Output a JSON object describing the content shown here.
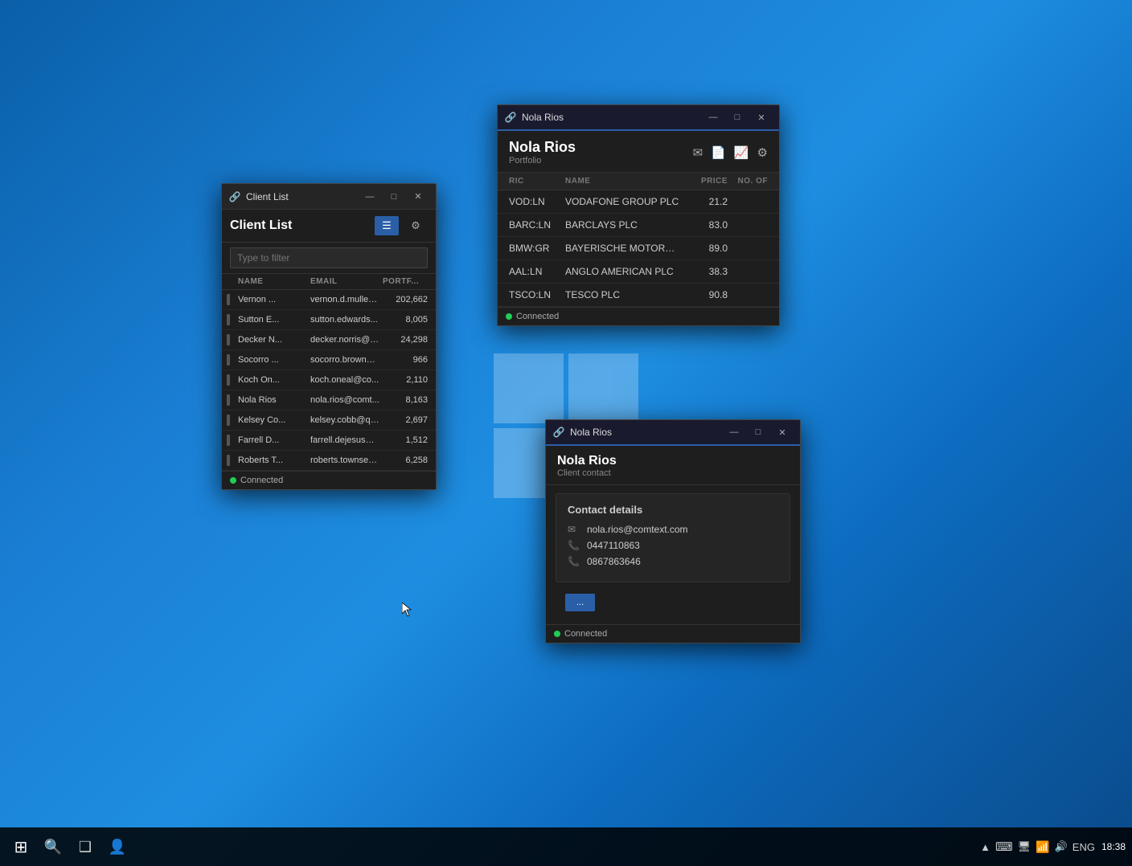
{
  "desktop": {
    "background": "blue-gradient"
  },
  "taskbar": {
    "icons": [
      {
        "name": "start-icon",
        "glyph": "⊞"
      },
      {
        "name": "search-icon",
        "glyph": "🔍"
      },
      {
        "name": "task-view-icon",
        "glyph": "❑"
      },
      {
        "name": "users-icon",
        "glyph": "👤"
      }
    ],
    "time": "18:38",
    "date": "",
    "sys_icons": [
      "▲",
      "⌨",
      "🖥",
      "🔊",
      "ENG"
    ]
  },
  "client_list_window": {
    "title": "Client List",
    "title_icon": "🔗",
    "controls": [
      "—",
      "□",
      "✕"
    ],
    "header_title": "Client List",
    "action_list": "≡",
    "action_settings": "⚙",
    "filter_placeholder": "Type to filter",
    "columns": {
      "indicator": "",
      "name": "NAME",
      "email": "EMAIL",
      "portfolio": "PORTF..."
    },
    "rows": [
      {
        "indicator": true,
        "name": "Vernon ...",
        "email": "vernon.d.mullen...",
        "portfolio": "202,662"
      },
      {
        "indicator": true,
        "name": "Sutton E...",
        "email": "sutton.edwards...",
        "portfolio": "8,005"
      },
      {
        "indicator": true,
        "name": "Decker N...",
        "email": "decker.norris@d...",
        "portfolio": "24,298"
      },
      {
        "indicator": true,
        "name": "Socorro ...",
        "email": "socorro.brown@...",
        "portfolio": "966"
      },
      {
        "indicator": true,
        "name": "Koch On...",
        "email": "koch.oneal@co...",
        "portfolio": "2,110"
      },
      {
        "indicator": true,
        "name": "Nola Rios",
        "email": "nola.rios@comt...",
        "portfolio": "8,163"
      },
      {
        "indicator": true,
        "name": "Kelsey Co...",
        "email": "kelsey.cobb@qo...",
        "portfolio": "2,697"
      },
      {
        "indicator": true,
        "name": "Farrell D...",
        "email": "farrell.dejesus@...",
        "portfolio": "1,512"
      },
      {
        "indicator": true,
        "name": "Roberts T...",
        "email": "roberts.townsen...",
        "portfolio": "6,258"
      }
    ],
    "status": "Connected"
  },
  "portfolio_window": {
    "title": "Nola Rios",
    "title_icon": "🔗",
    "controls": [
      "—",
      "□",
      "✕"
    ],
    "name": "Nola Rios",
    "subtitle": "Portfolio",
    "icons": [
      "✉",
      "📄",
      "📈",
      "⚙"
    ],
    "columns": {
      "ric": "RIC",
      "name": "NAME",
      "price": "PRICE",
      "no_of": "NO. OF"
    },
    "rows": [
      {
        "ric": "VOD:LN",
        "name": "VODAFONE GROUP PLC",
        "price": "21.2",
        "no_of": ""
      },
      {
        "ric": "BARC:LN",
        "name": "BARCLAYS PLC",
        "price": "83.0",
        "no_of": ""
      },
      {
        "ric": "BMW:GR",
        "name": "BAYERISCHE MOTOREN WERKE AG",
        "price": "89.0",
        "no_of": ""
      },
      {
        "ric": "AAL:LN",
        "name": "ANGLO AMERICAN PLC",
        "price": "38.3",
        "no_of": ""
      },
      {
        "ric": "TSCO:LN",
        "name": "TESCO PLC",
        "price": "90.8",
        "no_of": ""
      }
    ],
    "status": "Connected"
  },
  "contact_window": {
    "title": "Nola Rios",
    "title_icon": "🔗",
    "controls": [
      "—",
      "□",
      "✕"
    ],
    "name": "Nola Rios",
    "subtitle": "Client contact",
    "details_title": "Contact details",
    "email_icon": "✉",
    "email": "nola.rios@comtext.com",
    "phone1_icon": "📞",
    "phone1": "0447110863",
    "phone2_icon": "📞",
    "phone2": "0867863646",
    "button_label": "...",
    "status": "Connected"
  }
}
